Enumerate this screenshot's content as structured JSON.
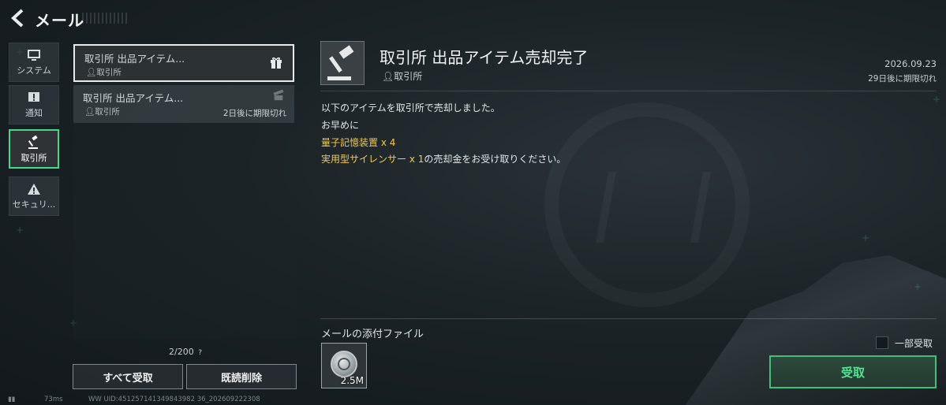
{
  "header": {
    "title": "メール"
  },
  "categories": [
    {
      "label": "システム",
      "icon": "monitor-icon",
      "active": false
    },
    {
      "label": "通知",
      "icon": "alert-square-icon",
      "active": false
    },
    {
      "label": "取引所",
      "icon": "gavel-icon",
      "active": true
    },
    {
      "label": "セキュリ...",
      "icon": "warning-triangle-icon",
      "active": false
    }
  ],
  "mails": [
    {
      "subject": "取引所 出品アイテム...",
      "sender": "取引所",
      "expire": "",
      "selected": true
    },
    {
      "subject": "取引所 出品アイテム...",
      "sender": "取引所",
      "expire": "2日後に期限切れ",
      "selected": false
    }
  ],
  "list": {
    "count": "2/200",
    "help": "?",
    "receive_all": "すべて受取",
    "delete_read": "既読削除"
  },
  "detail": {
    "title": "取引所 出品アイテム売却完了",
    "sender": "取引所",
    "date": "2026.09.23",
    "expire": "29日後に期限切れ",
    "line1": "以下のアイテムを取引所で売却しました。",
    "line2": "お早めに",
    "line3": "量子記憶装置 x 4",
    "line4_item": "実用型サイレンサー x 1",
    "line4_rest": "の売却金をお受け取りください。"
  },
  "attachments": {
    "label": "メールの添付ファイル",
    "items": [
      {
        "icon": "coin-icon",
        "qty": "2.5M"
      }
    ],
    "partial_label": "一部受取",
    "receive": "受取"
  },
  "footer": {
    "ping": "73ms",
    "uid": "WW UID:451257141349843982 36_202609222308"
  },
  "colors": {
    "accent": "#43d88a",
    "highlight": "#f2c94c"
  }
}
